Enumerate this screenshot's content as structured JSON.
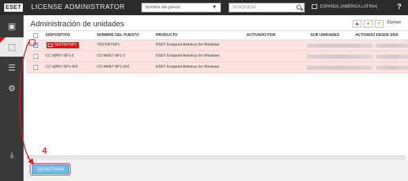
{
  "header": {
    "logo": "ESET",
    "title": "LICENSE ADMINISTRATOR",
    "dropdown_value": "Nombre del puesto",
    "search_placeholder": "BÚSQUEDA",
    "language": "ESPAÑOL (AMÉRICA LATINA)",
    "help": "?"
  },
  "sidebar": {
    "items": [
      {
        "icon": "dashboard-icon"
      },
      {
        "icon": "box-icon",
        "active": true
      },
      {
        "icon": "list-icon"
      },
      {
        "icon": "gear-icon"
      },
      {
        "icon": "download-icon"
      }
    ]
  },
  "main": {
    "title": "Administración de unidades",
    "status_buttons": [
      "▲",
      "●",
      "✓"
    ],
    "elements_label": "Elemen"
  },
  "table": {
    "columns": [
      "DISPOSITIVO",
      "NOMBRE DEL PUESTO",
      "PRODUCTO",
      "ACTIVADO POR",
      "SUB UNIDADES",
      "ACTIVADO DESDE ERA"
    ],
    "rows": [
      {
        "device": "TESTW7SP1",
        "seat": "TESTW7SP1",
        "product": "ESET Endpoint Antivirus for Windows",
        "checked": true
      },
      {
        "device": "CC-WIN7-SP1-2",
        "seat": "CC-WIN7-SP1-2",
        "product": "ESET Endpoint Antivirus for Windows",
        "checked": false
      },
      {
        "device": "CC-WIN7-SP1-001",
        "seat": "CC-WIN7-SP1-001",
        "product": "ESET Endpoint Antivirus for Windows",
        "checked": false
      }
    ]
  },
  "footer": {
    "deactivate_label": "DESACTIVAR"
  },
  "annotation": {
    "step": "4"
  },
  "colors": {
    "accent_red": "#d01c1c",
    "row_highlight": "#fbe3e2",
    "button_blue": "#72b7e6",
    "topbar": "#2b2b2b"
  }
}
